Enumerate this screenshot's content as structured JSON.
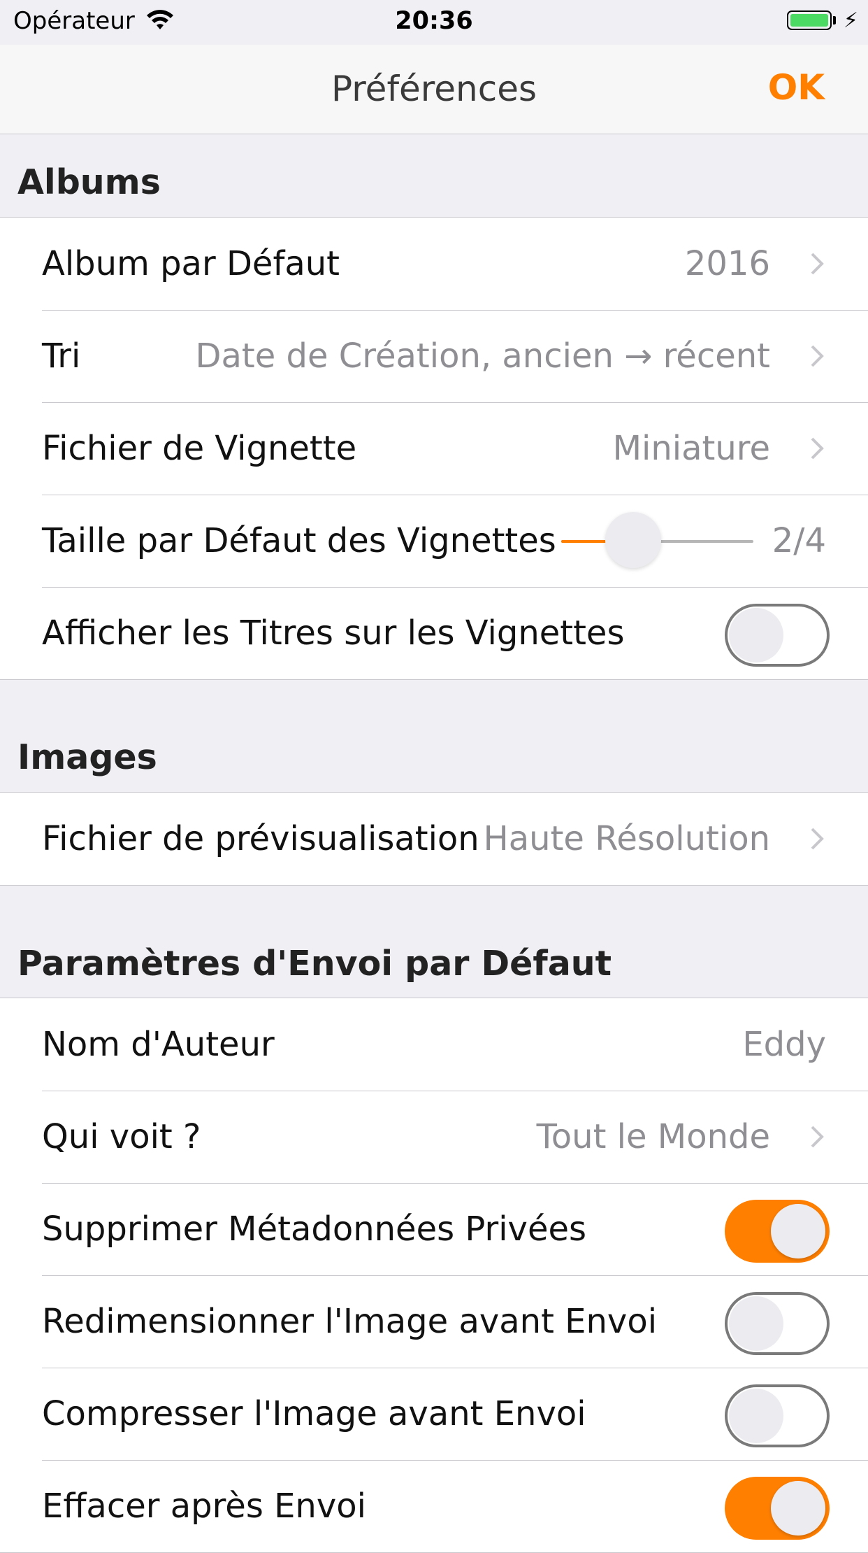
{
  "status_bar": {
    "carrier": "Opérateur",
    "time": "20:36",
    "battery_color": "#4cd964",
    "icons": [
      "wifi-icon",
      "battery-icon",
      "charging-bolt-icon"
    ]
  },
  "nav": {
    "title": "Préférences",
    "ok_label": "OK",
    "accent_color": "#ff7f00"
  },
  "albums": {
    "header": "Albums",
    "default_album": {
      "label": "Album par Défaut",
      "value": "2016"
    },
    "sort": {
      "label": "Tri",
      "value": "Date de Création, ancien → récent"
    },
    "thumbnail_file": {
      "label": "Fichier de Vignette",
      "value": "Miniature"
    },
    "thumbnail_size": {
      "label": "Taille par Défaut des Vignettes",
      "value": "2/4",
      "level": 0.25
    },
    "show_titles": {
      "label": "Afficher les Titres sur les Vignettes",
      "on": false
    }
  },
  "images": {
    "header": "Images",
    "preview_file": {
      "label": "Fichier de prévisualisation",
      "value": "Haute Résolution"
    }
  },
  "upload": {
    "header": "Paramètres d'Envoi par Défaut",
    "author": {
      "label": "Nom d'Auteur",
      "value": "Eddy"
    },
    "who_sees": {
      "label": "Qui voit ?",
      "value": "Tout le Monde"
    },
    "strip_metadata": {
      "label": "Supprimer Métadonnées Privées",
      "on": true
    },
    "resize": {
      "label": "Redimensionner l'Image avant Envoi",
      "on": false
    },
    "compress": {
      "label": "Compresser l'Image avant Envoi",
      "on": false
    },
    "delete_after": {
      "label": "Effacer après Envoi",
      "on": true
    }
  }
}
